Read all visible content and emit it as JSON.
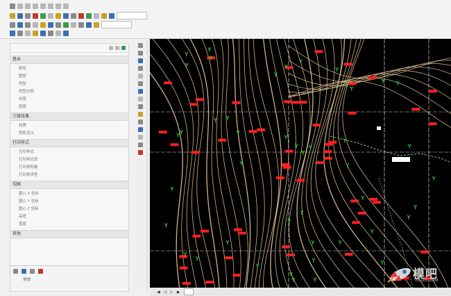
{
  "toolbar": {
    "layer_combo": "",
    "style_combo": ""
  },
  "panel": {
    "title": "",
    "sections": [
      {
        "title": "基本",
        "rows": [
          {
            "key": "颜色",
            "value": ""
          },
          {
            "key": "图层",
            "value": ""
          },
          {
            "key": "线型",
            "value": ""
          },
          {
            "key": "线型比例",
            "value": ""
          },
          {
            "key": "线宽",
            "value": ""
          },
          {
            "key": "厚度",
            "value": ""
          }
        ]
      },
      {
        "title": "三维效果",
        "rows": [
          {
            "key": "材质",
            "value": ""
          },
          {
            "key": "阴影显示",
            "value": ""
          }
        ]
      },
      {
        "title": "打印样式",
        "rows": [
          {
            "key": "打印样式",
            "value": ""
          },
          {
            "key": "打印样式表",
            "value": ""
          },
          {
            "key": "打印表附着",
            "value": ""
          },
          {
            "key": "打印表类型",
            "value": ""
          }
        ]
      },
      {
        "title": "视图",
        "rows": [
          {
            "key": "圆心 X 坐标",
            "value": ""
          },
          {
            "key": "圆心 Y 坐标",
            "value": ""
          },
          {
            "key": "圆心 Z 坐标",
            "value": ""
          },
          {
            "key": "高度",
            "value": ""
          },
          {
            "key": "宽度",
            "value": ""
          }
        ]
      },
      {
        "title": "其他",
        "rows": []
      }
    ],
    "footer_label": "常规"
  },
  "map": {
    "contour_color": "#e8c89a",
    "label_color": "#ff2020",
    "marker_color": "#30e030",
    "grid_color": "#d8d8d8",
    "boundary_color": "#7fd07f"
  },
  "watermark": {
    "text": "模吧",
    "url": "MOZ8.COM"
  }
}
